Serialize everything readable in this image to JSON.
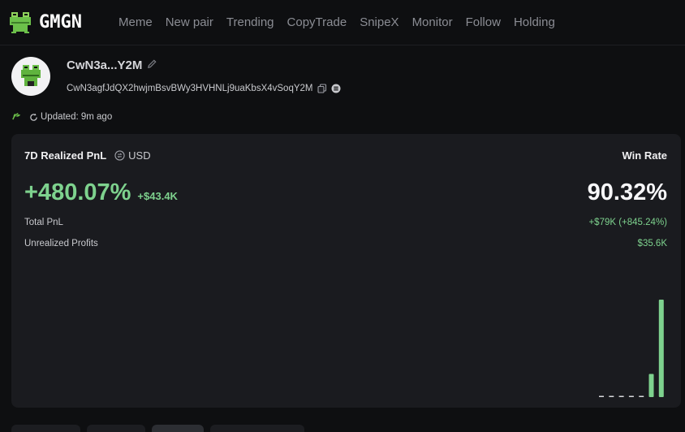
{
  "nav": {
    "logo_text": "GMGN",
    "items": [
      "Meme",
      "New pair",
      "Trending",
      "CopyTrade",
      "SnipeX",
      "Monitor",
      "Follow",
      "Holding"
    ]
  },
  "profile": {
    "name": "CwN3a...Y2M",
    "address": "CwN3agfJdQX2hwjmBsvBWy3HVHNLj9uaKbsX4vSoqY2M",
    "updated": "Updated: 9m ago"
  },
  "stats": {
    "title": "7D Realized PnL",
    "currency": "USD",
    "pnl_percent": "+480.07%",
    "pnl_usd": "+$43.4K",
    "win_rate_label": "Win Rate",
    "win_rate": "90.32%",
    "total_pnl_label": "Total PnL",
    "total_pnl": "+$79K (+845.24%)",
    "unrealized_label": "Unrealized Profits",
    "unrealized": "$35.6K"
  },
  "colors": {
    "accent_green": "#7ed28e",
    "background": "#0e0f11",
    "card": "#1a1b1f"
  },
  "chart_data": {
    "type": "bar",
    "categories": [
      "",
      "",
      "",
      "",
      "",
      "",
      ""
    ],
    "values": [
      0,
      0,
      0,
      0,
      0,
      9.5,
      40
    ],
    "title": "",
    "xlabel": "",
    "ylabel": "",
    "ylim": [
      0,
      40
    ]
  }
}
